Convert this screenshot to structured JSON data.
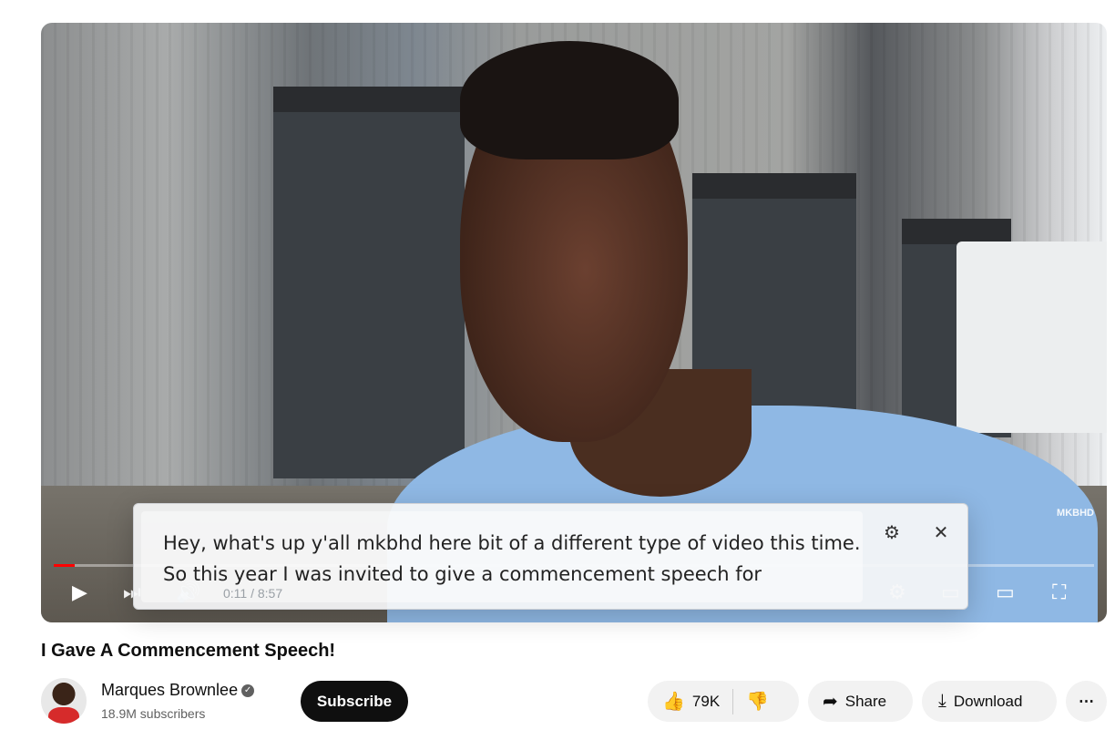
{
  "video": {
    "watermark": "MKBHD",
    "current_time": "0:11",
    "duration": "8:57",
    "time_display": "0:11 / 8:57",
    "progress_percent": 2,
    "caption": "Hey, what's up y'all mkbhd here bit of a different type of video this time. So this year I was invited to give a commencement speech for"
  },
  "title": "I Gave A Commencement Speech!",
  "channel": {
    "name": "Marques Brownlee",
    "subscribers": "18.9M subscribers",
    "subscribe_label": "Subscribe"
  },
  "actions": {
    "likes": "79K",
    "share": "Share",
    "download": "Download",
    "more": "⋯"
  },
  "colors": {
    "progress": "#ff0000",
    "subscribe_bg": "#0f0f0f",
    "pill_bg": "#f2f2f2"
  }
}
